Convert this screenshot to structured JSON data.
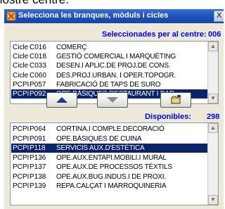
{
  "above_text": "nostre centre:",
  "window": {
    "title": "Selecciona les branques, mòduls i cicles",
    "close_label": "X"
  },
  "selected": {
    "label": "Seleccionades per al centre:",
    "count": "006",
    "rows": [
      {
        "category": "Cicle",
        "code": "C016",
        "name": "COMERÇ",
        "selected": false
      },
      {
        "category": "Cicle",
        "code": "C018",
        "name": "GESTIÓ COMERCIAL I MARQUÈTING",
        "selected": false
      },
      {
        "category": "Cicle",
        "code": "C033",
        "name": "DESEN.I APLIC.DE PROJ.DE CONS.",
        "selected": false
      },
      {
        "category": "Cicle",
        "code": "C060",
        "name": "DES.PROJ.URBAN. I OPER.TOPOGR.",
        "selected": false
      },
      {
        "category": "PCPI",
        "code": "P057",
        "name": "FABRICACIÓ DE TAPS DE SURO",
        "selected": false
      },
      {
        "category": "PCPI",
        "code": "P092",
        "name": "OPE.BÀSIQUES RESTAURANT I BAR",
        "selected": true
      }
    ]
  },
  "buttons": {
    "up": "up-arrow-icon",
    "down": "down-arrow-icon",
    "open": "folder-icon"
  },
  "available": {
    "label": "Disponibles:",
    "count": "298",
    "rows": [
      {
        "category": "PCPI",
        "code": "P064",
        "name": "CORTINA.I COMPLE.DECORACIÓ",
        "selected": false
      },
      {
        "category": "PCPI",
        "code": "P091",
        "name": "OPE.BÀSIQUES DE CUINA",
        "selected": false
      },
      {
        "category": "PCPI",
        "code": "P118",
        "name": "SERVICIS AUX.D'ESTÈTICA",
        "selected": true
      },
      {
        "category": "PCPI",
        "code": "P136",
        "name": "OPE.AUX.ENTAPI.MOBILI.I MURAL",
        "selected": false
      },
      {
        "category": "PCPI",
        "code": "P137",
        "name": "OPE.AUX.DE PROCESSOS TÈXTILS",
        "selected": false
      },
      {
        "category": "PCPI",
        "code": "P138",
        "name": "OPE.AUX.BUG.INDUS.I DE PROXI.",
        "selected": false
      },
      {
        "category": "PCPI",
        "code": "P139",
        "name": "REPA.CALÇAT I MARROQUINERIA",
        "selected": false
      }
    ]
  }
}
